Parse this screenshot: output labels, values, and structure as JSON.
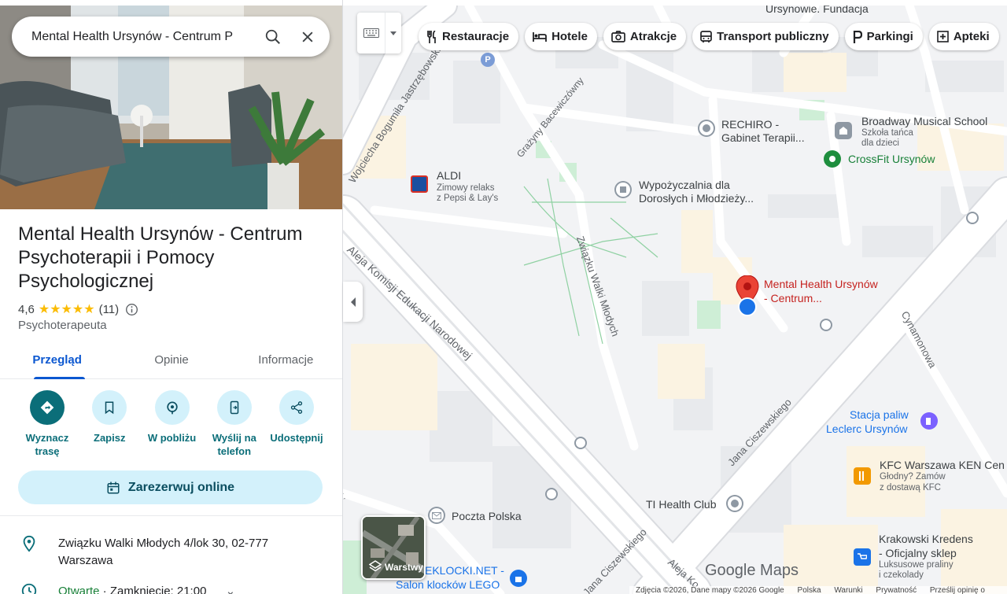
{
  "search": {
    "value": "Mental Health Ursynów - Centrum P"
  },
  "place": {
    "title": "Mental Health Ursynów - Centrum Psychoterapii i Pomocy Psychologicznej",
    "rating": "4,6",
    "stars": "★★★★★",
    "review_count": "(11)",
    "category": "Psychoterapeuta"
  },
  "tabs": [
    {
      "label": "Przegląd"
    },
    {
      "label": "Opinie"
    },
    {
      "label": "Informacje"
    }
  ],
  "actions": [
    {
      "label": "Wyznacz trasę",
      "icon": "directions-icon"
    },
    {
      "label": "Zapisz",
      "icon": "bookmark-icon"
    },
    {
      "label": "W pobliżu",
      "icon": "nearby-icon"
    },
    {
      "label": "Wyślij na telefon",
      "icon": "send-to-phone-icon"
    },
    {
      "label": "Udostępnij",
      "icon": "share-icon"
    }
  ],
  "reserve_label": "Zarezerwuj online",
  "address": "Związku Walki Młodych 4/lok 30, 02-777 Warszawa",
  "hours": {
    "open": "Otwarte",
    "rest": " · Zamknięcie: 21:00"
  },
  "chips": [
    {
      "label": "Restauracje",
      "icon": "fork-knife-icon"
    },
    {
      "label": "Hotele",
      "icon": "bed-icon"
    },
    {
      "label": "Atrakcje",
      "icon": "camera-icon"
    },
    {
      "label": "Transport publiczny",
      "icon": "bus-icon"
    },
    {
      "label": "Parkingi",
      "icon": "parking-icon"
    },
    {
      "label": "Apteki",
      "icon": "pharmacy-icon"
    }
  ],
  "map": {
    "labels": {
      "top_fundacja": "Ursynowie. Fundacja",
      "rechiro": "RECHIRO -",
      "rechiro2": "Gabinet Terapii...",
      "broadway": "Broadway Musical School",
      "broadway_sub1": "Szkoła tańca",
      "broadway_sub2": "dla dzieci",
      "crossfit": "CrossFit Ursynów",
      "aldi": "ALDI",
      "aldi_sub1": "Zimowy relaks",
      "aldi_sub2": "z Pepsi & Lay's",
      "library1": "Wypożyczalnia dla",
      "library2": "Dorosłych i Młodzieży...",
      "mh1": "Mental Health Ursynów",
      "mh2": "- Centrum...",
      "station1": "Stacja paliw",
      "station2": "Leclerc Ursynów",
      "kfc": "KFC Warszawa KEN Cen",
      "kfc_sub1": "Głodny? Zamów",
      "kfc_sub2": "z dostawą KFC",
      "ti": "TI Health Club",
      "poczta": "Poczta Polska",
      "klocki1": "EKLOCKI.NET -",
      "klocki2": "Salon klocków LEGO",
      "krakowski1": "Krakowski Kredens",
      "krakowski2": "- Oficjalny sklep",
      "krakowski_sub1": "Luksusowe praliny",
      "krakowski_sub2": "i czekolady"
    },
    "streets": {
      "jastrzebowski": "Wojciecha Bogumiła Jastrzębowski",
      "bacewicz": "Grażyny Bacewiczówny",
      "zwm": "Związku Walki Młodych",
      "ken": "Aleja Komisji Edukacji Narodowej",
      "cynamonowa": "Cynamonowa",
      "ciszewskiego": "Jana Ciszewskiego",
      "ciszewskiego2": "Jana Ciszewskiego",
      "aleja_bottom": "Aleja Ko",
      "left_bottom": "ski"
    },
    "layers_label": "Warstwy",
    "logo": "Google Maps",
    "footer": [
      "Zdjęcia ©2026, Dane mapy ©2026 Google",
      "Polska",
      "Warunki",
      "Prywatność",
      "Prześlij opinię o"
    ]
  }
}
